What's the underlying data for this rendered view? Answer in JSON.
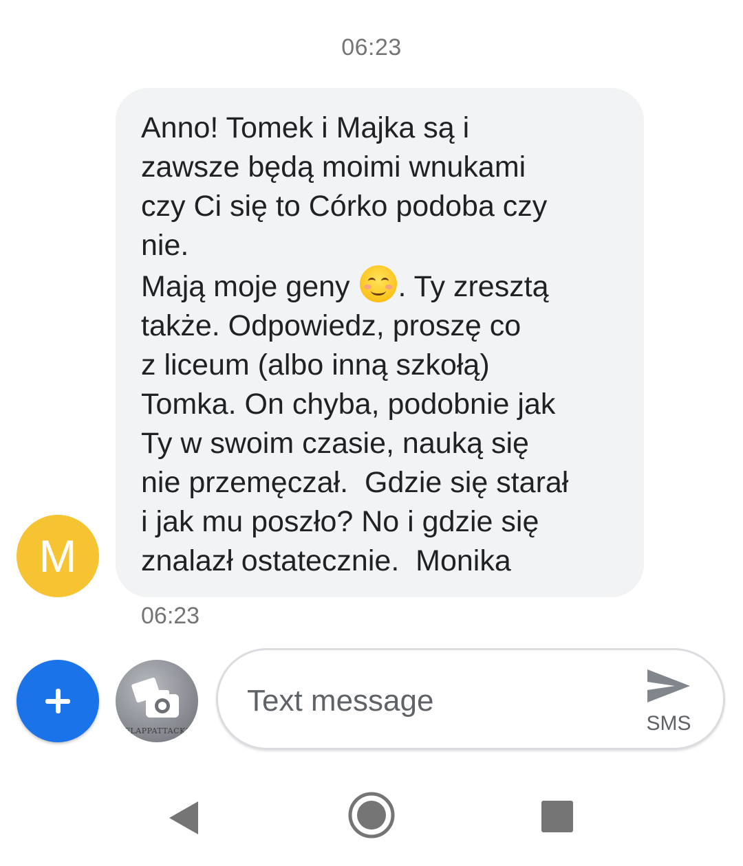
{
  "header": {
    "timestamp": "06:23"
  },
  "conversation": {
    "avatar_initial": "M",
    "avatar_color": "#f6c332",
    "message": {
      "line_1": "Anno! Tomek i Majka są i\nzawsze będą moimi wnukami\nczy Ci się to Córko podoba czy\nnie.\nMają moje geny ",
      "emoji": "smiling-face-with-smiling-eyes",
      "line_2": ". Ty zresztą\ntakże. Odpowiedz, proszę co\nz liceum (albo inną szkołą)\nTomka. On chyba, podobnie jak\nTy w swoim czasie, nauką się\nnie przemęczał.  Gdzie się starał\ni jak mu poszło? No i gdzie się\nznalazł ostatecznie.  Monika",
      "timestamp": "06:23"
    }
  },
  "compose": {
    "add_button_color": "#1a73e8",
    "placeholder": "Text message",
    "value": "",
    "send_label": "SMS",
    "gallery_caption": "FLAPPATTACK!"
  },
  "nav": {
    "back": "back-icon",
    "home": "home-icon",
    "recents": "recents-icon"
  }
}
